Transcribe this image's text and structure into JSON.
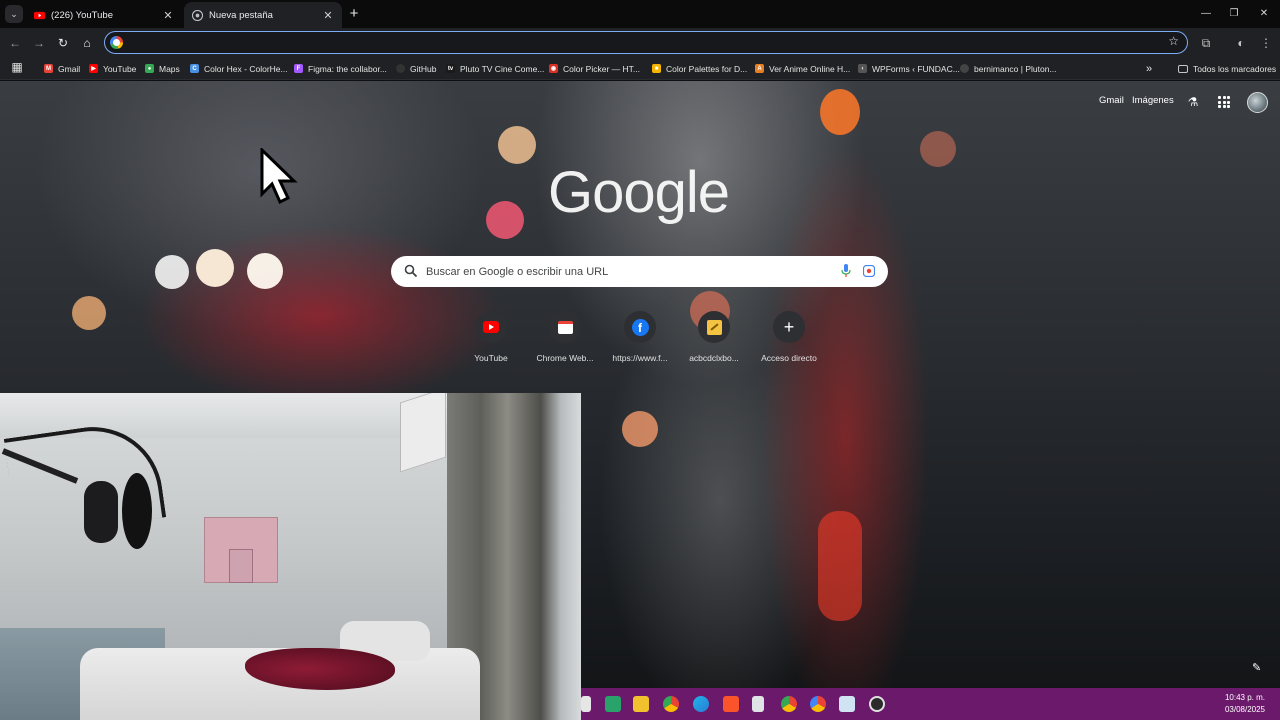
{
  "tabs": [
    {
      "title": "(226) YouTube",
      "favicon": "youtube-icon",
      "active": false
    },
    {
      "title": "Nueva pestaña",
      "favicon": "chrome-icon",
      "active": true
    }
  ],
  "toolbar": {
    "omnibox_value": ""
  },
  "bookmarks": [
    {
      "label": "Gmail",
      "icon": "gmail-icon",
      "color": "#ea4335"
    },
    {
      "label": "YouTube",
      "icon": "youtube-icon",
      "color": "#ff0000"
    },
    {
      "label": "Maps",
      "icon": "maps-icon",
      "color": "#34a853"
    },
    {
      "label": "Color Hex - ColorHe...",
      "icon": "colorhex-icon",
      "color": "#4a90e2"
    },
    {
      "label": "Figma: the collabor...",
      "icon": "figma-icon",
      "color": "#a259ff"
    },
    {
      "label": "GitHub",
      "icon": "github-icon",
      "color": "#333333"
    },
    {
      "label": "Pluto TV Cine Come...",
      "icon": "plutotv-icon",
      "color": "#1a1a1a"
    },
    {
      "label": "Color Picker — HT...",
      "icon": "colorpicker-icon",
      "color": "#d93025"
    },
    {
      "label": "Color Palettes for D...",
      "icon": "palettes-icon",
      "color": "#f4b400"
    },
    {
      "label": "Ver Anime Online H...",
      "icon": "anime-icon",
      "color": "#e67e22"
    },
    {
      "label": "WPForms ‹ FUNDAC...",
      "icon": "wpforms-icon",
      "color": "#555555"
    },
    {
      "label": "bernimanco | Pluton...",
      "icon": "pluton-icon",
      "color": "#444444"
    }
  ],
  "bookmarks_overflow": "»",
  "all_bookmarks_label": "Todos los marcadores",
  "ntp": {
    "gmail_link": "Gmail",
    "images_link": "Imágenes",
    "logo_text": "Google",
    "search_placeholder": "Buscar en Google o escribir una URL",
    "shortcuts": [
      {
        "title": "YouTube",
        "icon": "youtube-icon"
      },
      {
        "title": "Chrome Web...",
        "icon": "chrome-web-store-icon"
      },
      {
        "title": "https://www.f...",
        "icon": "facebook-icon"
      },
      {
        "title": "acbcdclxbo...",
        "icon": "notes-icon"
      },
      {
        "title": "Acceso directo",
        "icon": "plus-icon"
      }
    ]
  },
  "taskbar": {
    "time": "10:43 p. m.",
    "date": "03/08/2025",
    "apps": [
      "file-icon",
      "store-icon",
      "folder-icon",
      "chrome-icon",
      "edge-icon",
      "brave-icon",
      "calculator-icon",
      "chrome-profile-icon",
      "chrome-dev-icon",
      "photos-icon",
      "app-icon"
    ]
  },
  "colors": {
    "accent": "#7cacf8",
    "taskbar": "#6b1a6b",
    "tab_bg": "#202124"
  }
}
